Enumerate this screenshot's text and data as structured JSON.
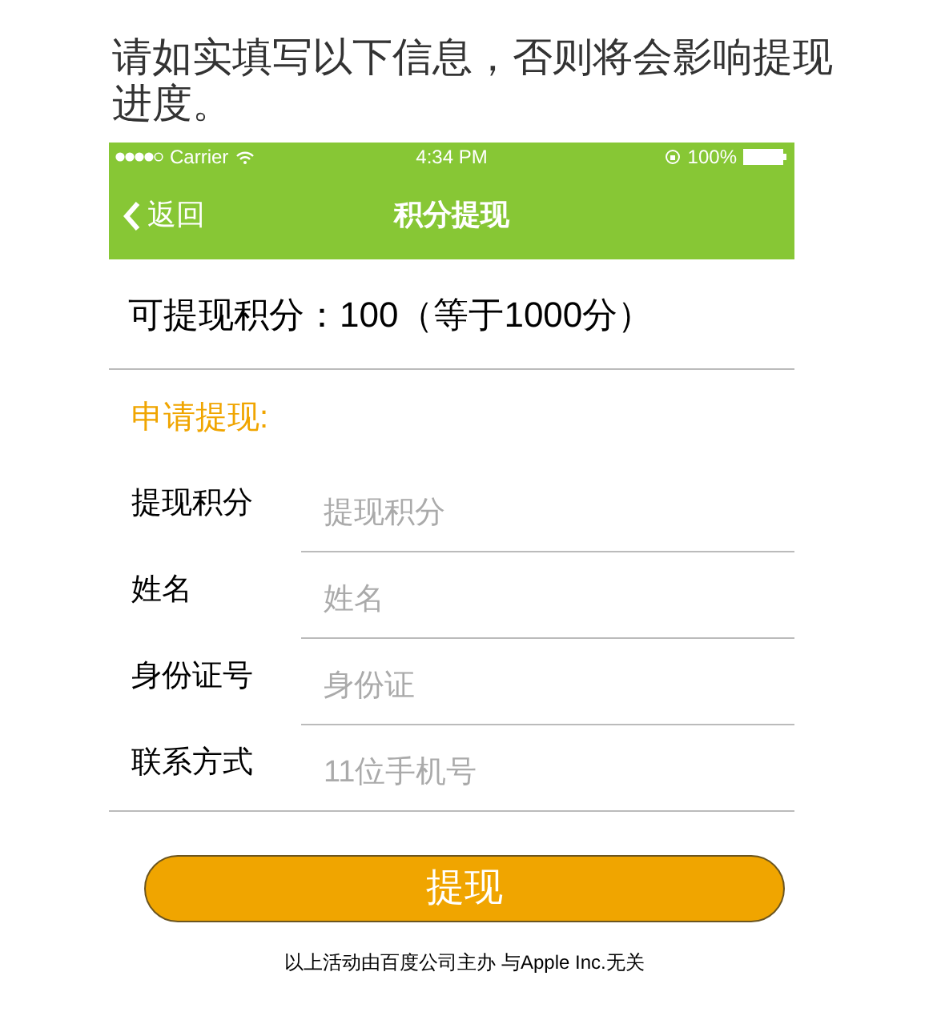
{
  "instruction": "请如实填写以下信息，否则将会影响提现进度。",
  "status_bar": {
    "carrier": "Carrier",
    "time": "4:34 PM",
    "battery": "100%"
  },
  "nav": {
    "back": "返回",
    "title": "积分提现"
  },
  "balance": "可提现积分：100（等于1000分）",
  "section_title": "申请提现:",
  "fields": [
    {
      "label": "提现积分",
      "placeholder": "提现积分"
    },
    {
      "label": "姓名",
      "placeholder": "姓名"
    },
    {
      "label": "身份证号",
      "placeholder": "身份证"
    },
    {
      "label": "联系方式",
      "placeholder": "11位手机号"
    }
  ],
  "submit": "提现",
  "footer": "以上活动由百度公司主办 与Apple Inc.无关"
}
